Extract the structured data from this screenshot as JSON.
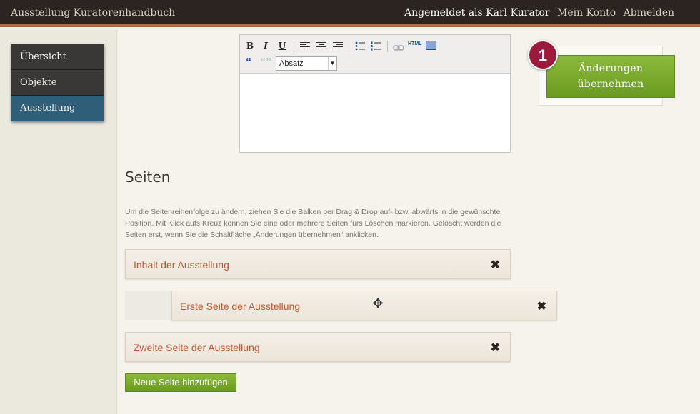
{
  "header": {
    "app_title": "Ausstellung Kuratorenhandbuch",
    "user_label": "Angemeldet als Karl Kurator",
    "account_link": "Mein Konto",
    "logout_link": "Abmelden"
  },
  "sidebar": {
    "items": [
      {
        "label": "Übersicht",
        "active": false
      },
      {
        "label": "Objekte",
        "active": false
      },
      {
        "label": "Ausstellung",
        "active": true
      }
    ]
  },
  "editor": {
    "toolbar": {
      "bold": "B",
      "italic": "I",
      "underline": "U",
      "html_label": "HTML",
      "format_value": "Absatz"
    }
  },
  "save_panel": {
    "badge": "1",
    "button_label": "Änderungen übernehmen"
  },
  "pages": {
    "title": "Seiten",
    "help": "Um die Seitenreihenfolge zu ändern, ziehen Sie die Balken per Drag & Drop auf- bzw. abwärts in die gewünschte Position. Mit Klick aufs Kreuz können Sie eine oder mehrere Seiten fürs Löschen markieren. Gelöscht werden die Seiten erst, wenn Sie die Schaltfläche „Änderungen übernehmen“ anklicken.",
    "items": [
      {
        "label": "Inhalt der Ausstellung"
      },
      {
        "label": "Erste Seite der Ausstellung"
      },
      {
        "label": "Zweite Seite der Ausstellung"
      }
    ],
    "remove_glyph": "✖",
    "add_button": "Neue Seite hinzufügen"
  },
  "colors": {
    "topbar": "#2b2420",
    "accent_border": "#b26a47",
    "active_nav": "#2f5e78",
    "button_green": "#7aa82b",
    "page_label": "#c0582e",
    "badge": "#9e1a3c"
  }
}
